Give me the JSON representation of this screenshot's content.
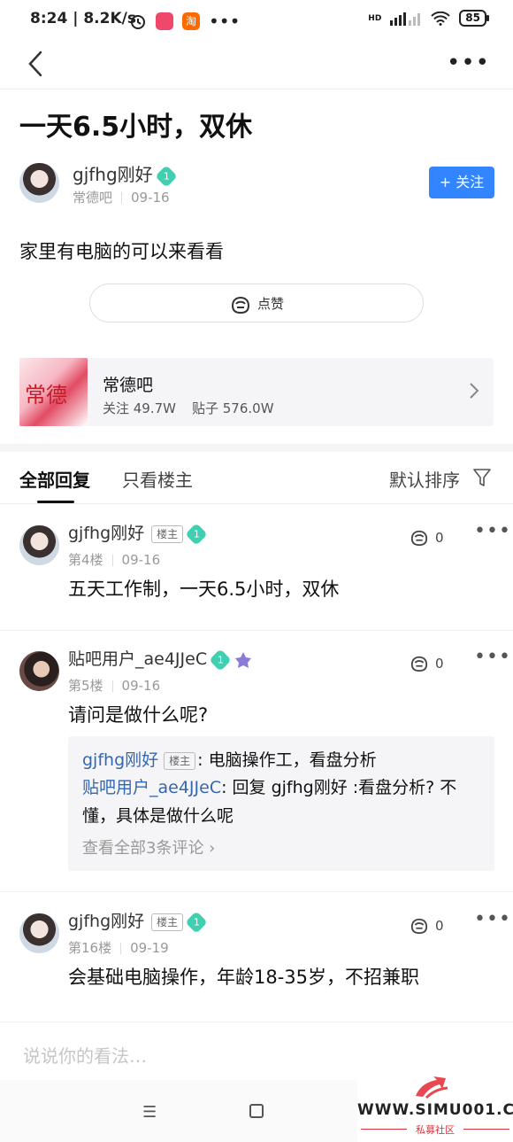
{
  "status_bar": {
    "time": "8:24",
    "speed": "8.2K/s",
    "battery": "85",
    "network": "HD"
  },
  "nav": {
    "back_icon": "chevron-left-icon",
    "more_icon": "more-dots-icon"
  },
  "post": {
    "title": "一天6.5小时，双休",
    "author": "gjfhg刚好",
    "author_level": "1",
    "forum": "常德吧",
    "date": "09-16",
    "follow_label": "+ 关注",
    "body": "家里有电脑的可以来看看",
    "like_label": "点赞"
  },
  "forum_card": {
    "name": "常德吧",
    "image_text": "常德",
    "followers": "关注 49.7W",
    "posts": "贴子 576.0W"
  },
  "tabs": {
    "all": "全部回复",
    "op_only": "只看楼主",
    "sort": "默认排序"
  },
  "replies": [
    {
      "name": "gjfhg刚好",
      "badge": "楼主",
      "level": "1",
      "floor": "第4楼",
      "date": "09-16",
      "likes": "0",
      "text": "五天工作制，一天6.5小时，双休"
    },
    {
      "name": "贴吧用户_ae4JJeC",
      "badge": "",
      "level": "1",
      "floor": "第5楼",
      "date": "09-16",
      "likes": "0",
      "text": "请问是做什么呢?",
      "sub": {
        "c1_user": "gjfhg刚好",
        "c1_badge": "楼主",
        "c1_text": ": 电脑操作工，看盘分析",
        "c2_user": "贴吧用户_ae4JJeC",
        "c2_text": ": 回复 gjfhg刚好 :看盘分析? 不懂，具体是做什么呢",
        "more": "查看全部3条评论"
      }
    },
    {
      "name": "gjfhg刚好",
      "badge": "楼主",
      "level": "1",
      "floor": "第16楼",
      "date": "09-19",
      "likes": "0",
      "text": "会基础电脑操作，年龄18-35岁，不招兼职"
    }
  ],
  "input": {
    "placeholder": "说说你的看法…"
  },
  "watermark": {
    "site": "WWW.SIMU001.CN",
    "sub": "私募社区"
  },
  "colors": {
    "accent": "#3385ff",
    "link": "#3467b3",
    "level_badge": "#3ed0b0"
  }
}
